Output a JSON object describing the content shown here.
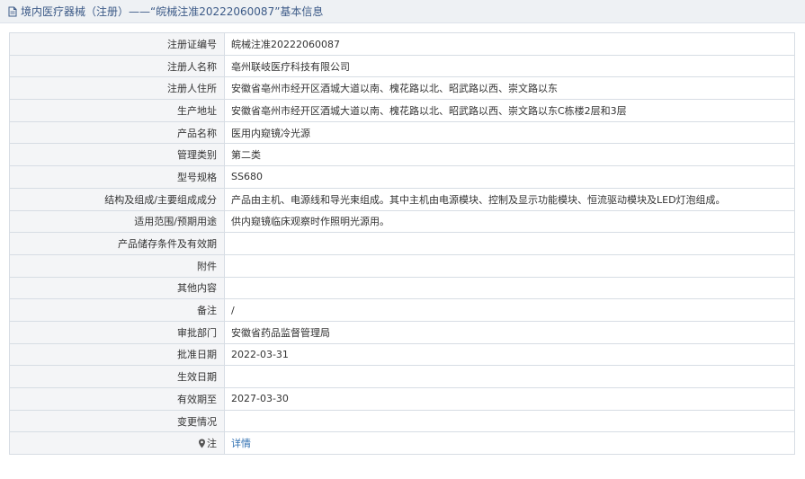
{
  "header": {
    "title": "境内医疗器械（注册）——“皖械注准20222060087”基本信息",
    "icon": "document-icon"
  },
  "rows": [
    {
      "label": "注册证编号",
      "value": "皖械注准20222060087"
    },
    {
      "label": "注册人名称",
      "value": "亳州联岐医疗科技有限公司"
    },
    {
      "label": "注册人住所",
      "value": "安徽省亳州市经开区酒城大道以南、槐花路以北、昭武路以西、崇文路以东"
    },
    {
      "label": "生产地址",
      "value": "安徽省亳州市经开区酒城大道以南、槐花路以北、昭武路以西、崇文路以东C栋楼2层和3层"
    },
    {
      "label": "产品名称",
      "value": "医用内窥镜冷光源"
    },
    {
      "label": "管理类别",
      "value": "第二类"
    },
    {
      "label": "型号规格",
      "value": "SS680"
    },
    {
      "label": "结构及组成/主要组成成分",
      "value": "产品由主机、电源线和导光束组成。其中主机由电源模块、控制及显示功能模块、恒流驱动模块及LED灯泡组成。"
    },
    {
      "label": "适用范围/预期用途",
      "value": "供内窥镜临床观察时作照明光源用。"
    },
    {
      "label": "产品储存条件及有效期",
      "value": ""
    },
    {
      "label": "附件",
      "value": ""
    },
    {
      "label": "其他内容",
      "value": ""
    },
    {
      "label": "备注",
      "value": "/"
    },
    {
      "label": "审批部门",
      "value": "安徽省药品监督管理局"
    },
    {
      "label": "批准日期",
      "value": "2022-03-31"
    },
    {
      "label": "生效日期",
      "value": ""
    },
    {
      "label": "有效期至",
      "value": "2027-03-30"
    },
    {
      "label": "变更情况",
      "value": ""
    }
  ],
  "note": {
    "label": "注",
    "icon": "map-pin-icon",
    "link_text": "详情"
  },
  "colors": {
    "header_bg": "#eef1f4",
    "title": "#3c5a87",
    "label_bg": "#f4f5f7",
    "border": "#d7dde4",
    "link": "#2f6fb1"
  }
}
